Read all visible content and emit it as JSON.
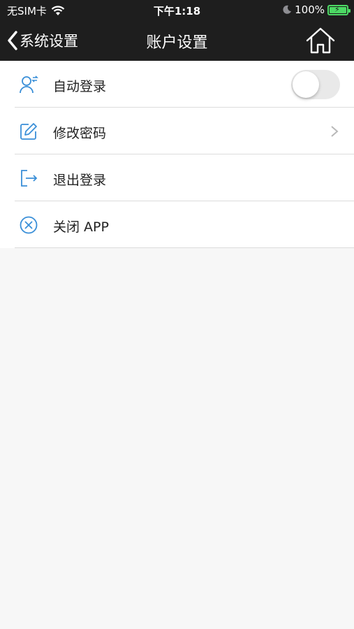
{
  "status_bar": {
    "carrier": "无SIM卡",
    "time": "下午1:18",
    "battery_percent": "100%",
    "wifi_icon": "wifi-icon",
    "moon_icon": "moon-icon"
  },
  "nav": {
    "back_label": "系统设置",
    "title": "账户设置",
    "home_icon": "home-icon",
    "bg_color": "#1e1e1e"
  },
  "accent_color": "#3a8fd8",
  "rows": [
    {
      "label": "自动登录",
      "icon": "user-switch-icon",
      "control": "toggle",
      "toggle_on": false
    },
    {
      "label": "修改密码",
      "icon": "edit-icon",
      "control": "chevron"
    },
    {
      "label": "退出登录",
      "icon": "logout-icon",
      "control": "none"
    },
    {
      "label": "关闭 APP",
      "icon": "close-circle-icon",
      "control": "none"
    }
  ]
}
